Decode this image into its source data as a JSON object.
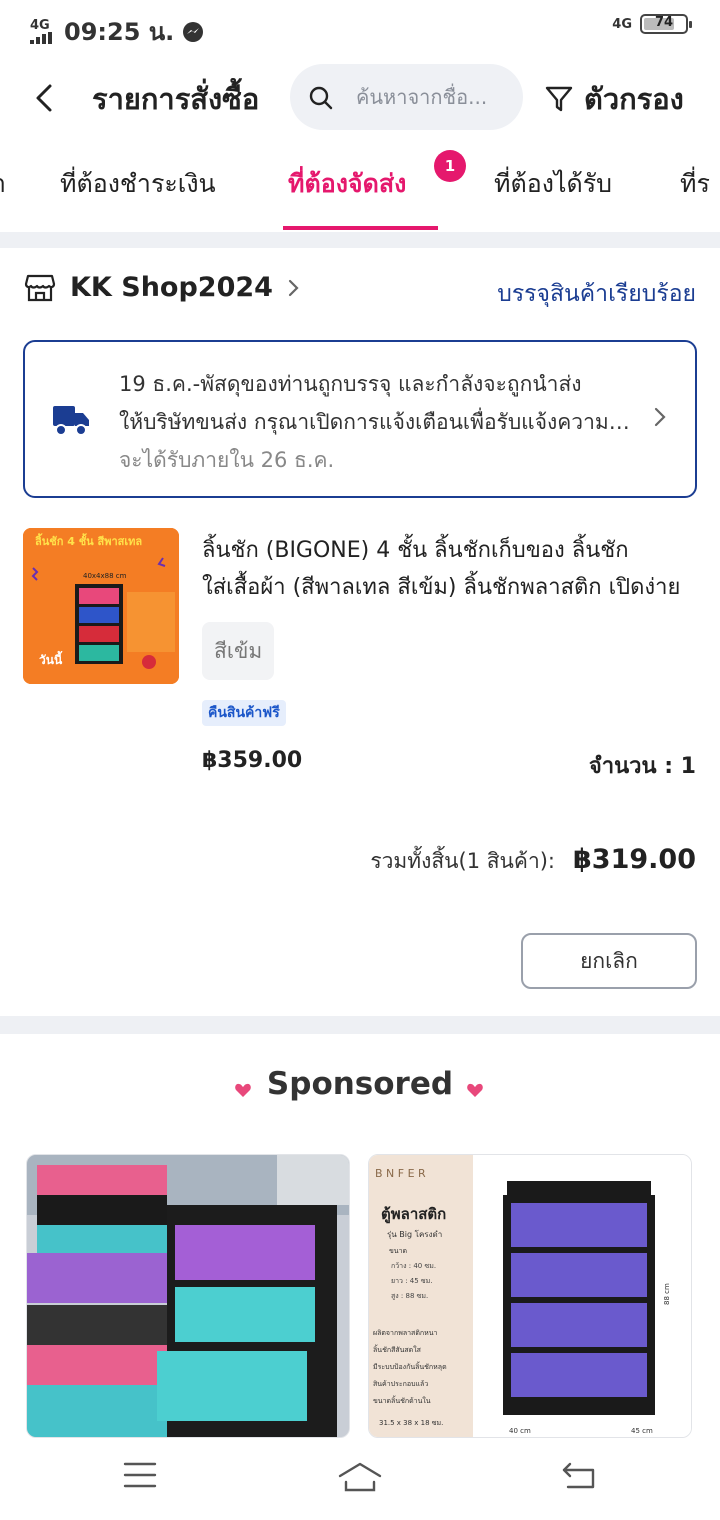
{
  "status_bar": {
    "network_left": "4G",
    "time": "09:25 น.",
    "network_right": "4G",
    "battery": "74"
  },
  "header": {
    "title": "รายการสั่งซื้อ",
    "search_placeholder": "ค้นหาจากชื่อ...",
    "filter_label": "ตัวกรอง"
  },
  "tabs": [
    {
      "label": "า"
    },
    {
      "label": "ที่ต้องชำระเงิน"
    },
    {
      "label": "ที่ต้องจัดส่ง",
      "active": true,
      "badge": "1"
    },
    {
      "label": "ที่ต้องได้รับ"
    },
    {
      "label": "ที่ร"
    }
  ],
  "colors": {
    "accent": "#e5186d",
    "navy": "#1b3d92",
    "divider": "#eef0f4"
  },
  "order": {
    "shop_name": "KK Shop2024",
    "status": "บรรจุสินค้าเรียบร้อย",
    "shipping": {
      "line1": "19 ธ.ค.-พัสดุของท่านถูกบรรจุ และกำลังจะถูกนำส่ง",
      "line2": "ให้บริษัทขนส่ง กรุณาเปิดการแจ้งเตือนเพื่อรับแจ้งความคืบหน้า",
      "eta": "จะได้รับภายใน 26 ธ.ค."
    },
    "product": {
      "title_line1": "ลิ้นชัก (BIGONE)  4 ชั้น ลิ้นชักเก็บของ ลิ้นชัก",
      "title_line2": "ใส่เสื้อผ้า (สีพาลเทล สีเข้ม) ลิ้นชักพลาสติก เปิดง่าย",
      "variant": "สีเข้ม",
      "tag": "คืนสินค้าฟรี",
      "price": "฿359.00",
      "quantity": "จำนวน : 1",
      "thumb_title": "ลิ้นชัก 4 ชั้น สีพาสเทล",
      "thumb_size": "40x4x88 cm",
      "thumb_today": "วันนี้"
    },
    "total_label": "รวมทั้งสิ้น(1 สินค้า):",
    "total_amount": "฿319.00",
    "cancel_label": "ยกเลิก"
  },
  "sponsored": {
    "heading": "Sponsored",
    "card2": {
      "brand": "B  N F E R",
      "title": "ตู้พลาสติก",
      "subtitle": "รุ่น Big โครงดำ",
      "size_heading": "ขนาด",
      "specs": [
        "กว้าง : 40 ซม.",
        "ยาว : 45 ซม.",
        "สูง : 88 ซม."
      ],
      "features": [
        "ผลิตจากพลาสติกหนา",
        "ลิ้นชักสีสันสดใส",
        "มีระบบป้องกันลิ้นชักหลุด",
        "สินค้าประกอบแล้ว",
        "ขนาดลิ้นชักด้านใน"
      ],
      "inner_size": "31.5 x 38 x 18 ซม.",
      "height_dim": "88 cm",
      "width_dim": "40 cm",
      "depth_dim": "45 cm"
    }
  },
  "nav": {
    "icons": [
      "menu-icon",
      "home-icon",
      "back-icon"
    ]
  }
}
